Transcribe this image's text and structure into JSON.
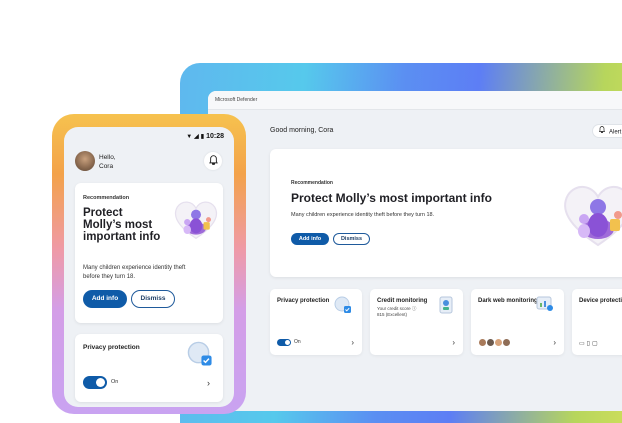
{
  "desktop": {
    "window_title": "Microsoft Defender",
    "greeting": "Good morning, Cora",
    "alert_label": "Alert",
    "recommendation": {
      "label": "Recommendation",
      "title": "Protect Molly’s most important info",
      "body": "Many children experience identity theft before they turn 18.",
      "add_button": "Add info",
      "dismiss_button": "Dismiss"
    },
    "tiles": [
      {
        "title": "Privacy protection",
        "status": "On"
      },
      {
        "title": "Credit monitoring",
        "sub": "Your credit score ⓘ",
        "sub2": "815 (Excellent)"
      },
      {
        "title": "Dark web monitoring"
      },
      {
        "title": "Device protection"
      }
    ]
  },
  "phone": {
    "time": "10:28",
    "greeting_line1": "Hello,",
    "greeting_line2": "Cora",
    "recommendation": {
      "label": "Recommendation",
      "title": "Protect Molly’s most important info",
      "body": "Many children experience identity theft before they turn 18.",
      "add_button": "Add info",
      "dismiss_button": "Dismiss"
    },
    "privacy": {
      "title": "Privacy protection",
      "status": "On"
    }
  },
  "colors": {
    "primary_button": "#0f5ba8",
    "background": "#eef1f5"
  }
}
